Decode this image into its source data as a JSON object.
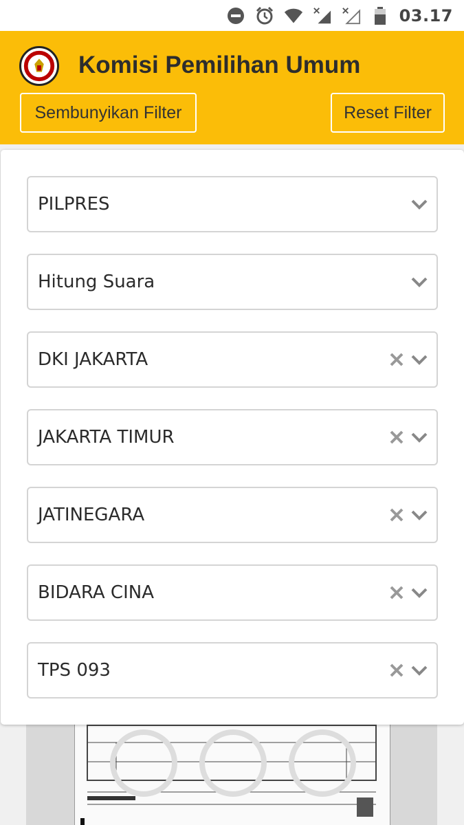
{
  "status_bar": {
    "time": "03.17",
    "icons": [
      "do-not-disturb-icon",
      "alarm-icon",
      "wifi-icon",
      "signal-x-icon",
      "signal-x-icon",
      "battery-icon"
    ]
  },
  "header": {
    "title": "Komisi Pemilihan Umum",
    "logo_icon": "kpu-logo-icon",
    "hide_filter_label": "Sembunyikan Filter",
    "reset_filter_label": "Reset Filter",
    "background_color": "#fbbd08"
  },
  "filters": [
    {
      "value": "PILPRES",
      "clearable": false
    },
    {
      "value": "Hitung Suara",
      "clearable": false
    },
    {
      "value": "DKI JAKARTA",
      "clearable": true
    },
    {
      "value": "JAKARTA TIMUR",
      "clearable": true
    },
    {
      "value": "JATINEGARA",
      "clearable": true
    },
    {
      "value": "BIDARA CINA",
      "clearable": true
    },
    {
      "value": "TPS 093",
      "clearable": true
    }
  ],
  "document_preview": {
    "description_icon": "scanned-form-image"
  }
}
